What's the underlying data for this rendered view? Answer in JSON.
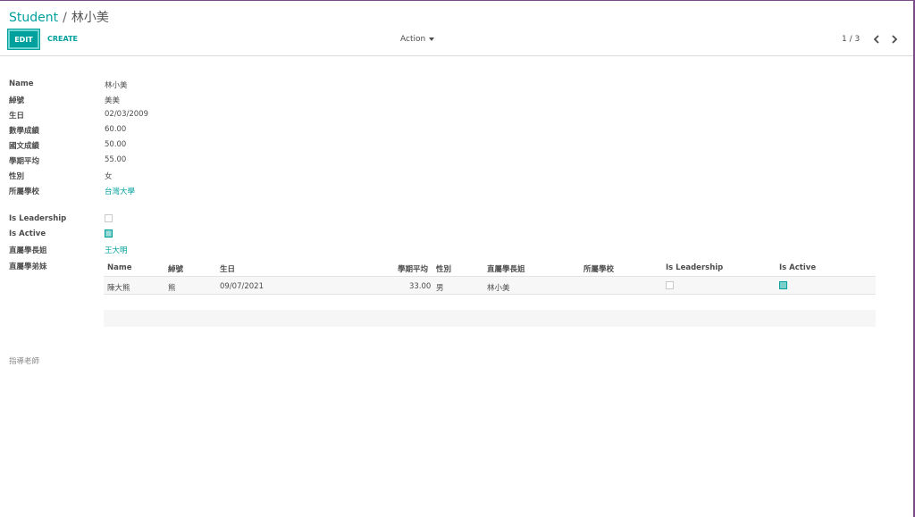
{
  "breadcrumb": {
    "parent": "Student",
    "separator": "/",
    "current": "林小美"
  },
  "toolbar": {
    "edit_label": "EDIT",
    "create_label": "CREATE",
    "action_label": "Action"
  },
  "pager": {
    "value": "1 / 3"
  },
  "form": {
    "fields": [
      {
        "label": "Name",
        "value": "林小美"
      },
      {
        "label": "綽號",
        "value": "美美"
      },
      {
        "label": "生日",
        "value": "02/03/2009"
      },
      {
        "label": "數學成績",
        "value": "60.00"
      },
      {
        "label": "國文成績",
        "value": "50.00"
      },
      {
        "label": "學期平均",
        "value": "55.00"
      },
      {
        "label": "性別",
        "value": "女"
      },
      {
        "label": "所屬學校",
        "value": "台灣大學"
      }
    ],
    "is_leadership": {
      "label": "Is Leadership",
      "checked": false
    },
    "is_active": {
      "label": "Is Active",
      "checked": true
    },
    "senior": {
      "label": "直屬學長姐",
      "value": "王大明"
    },
    "junior_label": "直屬學弟妹",
    "advisor_label": "指導老師"
  },
  "juniors_table": {
    "columns": [
      "Name",
      "綽號",
      "生日",
      "學期平均",
      "性別",
      "直屬學長姐",
      "所屬學校",
      "Is Leadership",
      "Is Active"
    ],
    "rows": [
      {
        "name": "陳大熊",
        "nickname": "熊",
        "birthday": "09/07/2021",
        "average": "33.00",
        "gender": "男",
        "senior": "林小美",
        "school": "",
        "is_leadership": false,
        "is_active": true
      }
    ]
  },
  "colors": {
    "accent": "#00a09d",
    "checked_fill": "#7ccfca"
  }
}
